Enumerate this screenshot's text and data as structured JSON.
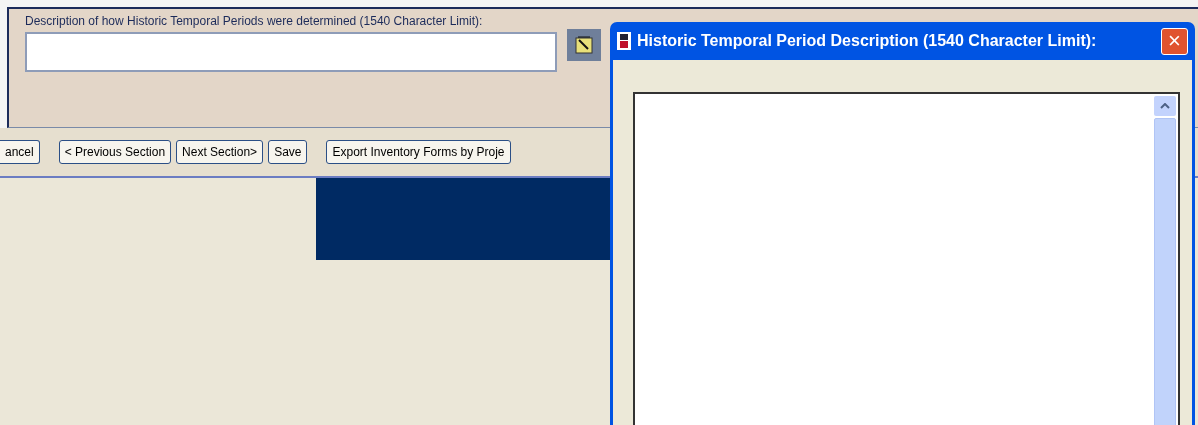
{
  "form": {
    "label": "Description of how Historic Temporal Periods were determined (1540 Character Limit):"
  },
  "buttons": [
    {
      "label": "ancel"
    },
    {
      "label": "< Previous Section"
    },
    {
      "label": "Next Section>"
    },
    {
      "label": "Save"
    },
    {
      "label": "Export Inventory Forms by Proje"
    }
  ],
  "dialog": {
    "title": "Historic Temporal Period Description (1540 Character Limit):",
    "close": "×"
  }
}
